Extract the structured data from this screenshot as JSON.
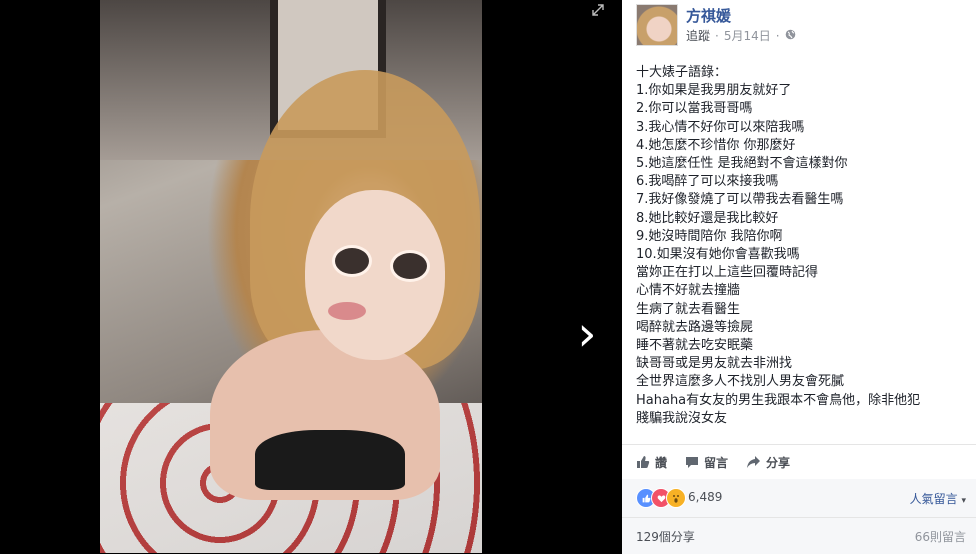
{
  "post": {
    "author": "方祺媛",
    "follow_label": "追蹤",
    "date": "5月14日",
    "separator": "·",
    "text_lines": [
      "十大婊子語錄：",
      "1.你如果是我男朋友就好了",
      "2.你可以當我哥哥嗎",
      "3.我心情不好你可以來陪我嗎",
      "4.她怎麼不珍惜你 你那麼好",
      "5.她這麼任性 是我絕對不會這樣對你",
      "6.我喝醉了可以來接我嗎",
      "7.我好像發燒了可以帶我去看醫生嗎",
      "8.她比較好還是我比較好",
      "9.她沒時間陪你 我陪你啊",
      "10.如果沒有她你會喜歡我嗎",
      "當妳正在打以上這些回覆時記得",
      "心情不好就去撞牆",
      "生病了就去看醫生",
      "喝醉就去路邊等撿屍",
      "睡不著就去吃安眠藥",
      "缺哥哥或是男友就去非洲找",
      "全世界這麼多人不找別人男友會死膩",
      "Hahaha有女友的男生我跟本不會鳥他，除非他犯",
      "賤騙我說沒女友"
    ]
  },
  "actions": {
    "like": "讚",
    "comment": "留言",
    "share": "分享"
  },
  "reactions": {
    "count": "6,489",
    "sort_label": "人氣留言",
    "sort_caret": "▾"
  },
  "footer": {
    "shares": "129個分享",
    "comments": "66則留言"
  },
  "nav": {
    "next": "›",
    "prev": "‹"
  },
  "colors": {
    "link": "#365899",
    "like_blue": "#5890ff",
    "love_red": "#f25268",
    "wow_yellow": "#f7b125"
  }
}
